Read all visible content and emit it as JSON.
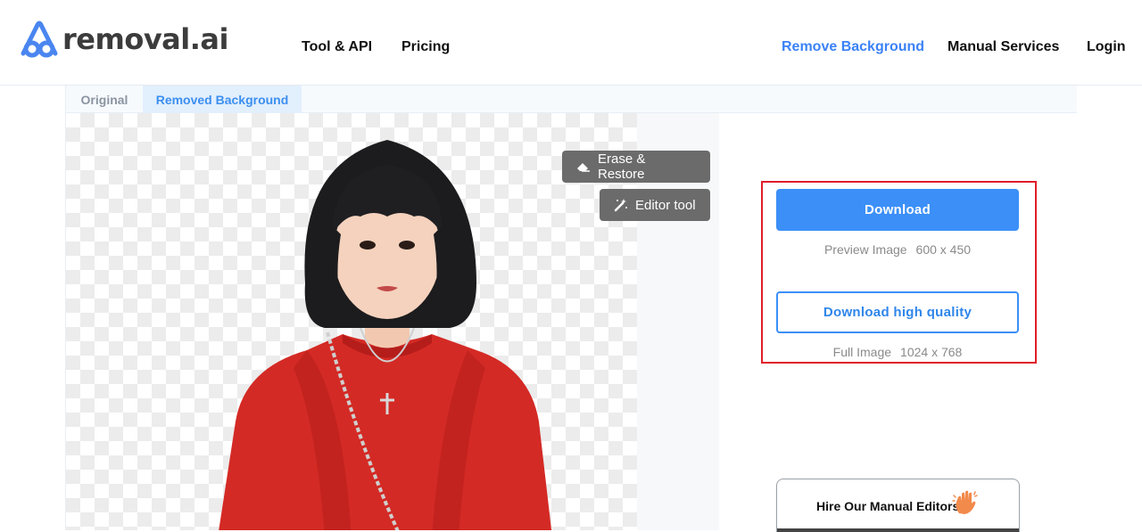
{
  "header": {
    "logo_text": "removal.ai",
    "nav": {
      "tool_api": "Tool & API",
      "pricing": "Pricing",
      "remove_background": "Remove Background",
      "manual_services": "Manual Services",
      "login": "Login"
    }
  },
  "tabs": {
    "original": "Original",
    "removed_background": "Removed Background"
  },
  "tools": {
    "erase_restore": "Erase & Restore",
    "editor_tool": "Editor tool"
  },
  "download": {
    "button_label": "Download",
    "preview_label": "Preview Image",
    "preview_size": "600 x 450",
    "hq_button_label": "Download high quality",
    "full_label": "Full Image",
    "full_size": "1024 x 768"
  },
  "hire": {
    "label": "Hire Our Manual Editors"
  },
  "colors": {
    "accent": "#3b8ff7",
    "highlight_border": "#e01e2b",
    "nav_active": "#3b82f6"
  }
}
